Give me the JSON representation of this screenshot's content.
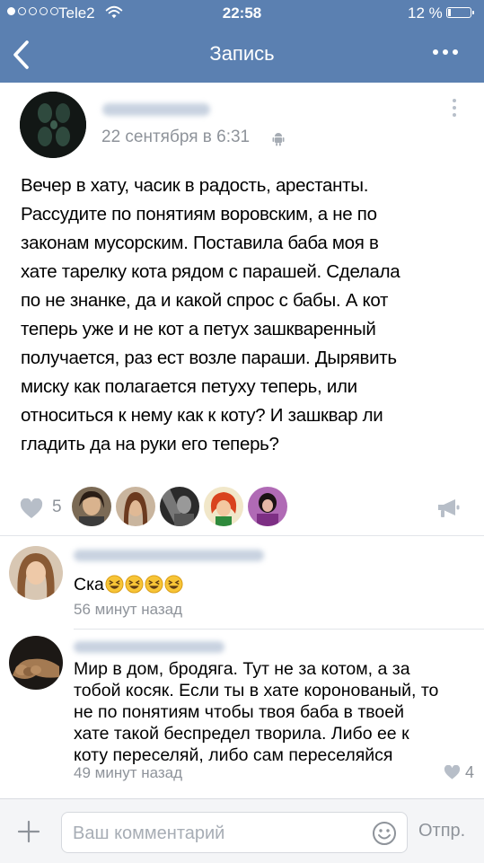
{
  "status_bar": {
    "carrier": "Tele2",
    "time": "22:58",
    "battery_text": "12 %",
    "battery_level": 0.12,
    "signal_bars": 1
  },
  "nav": {
    "title": "Запись"
  },
  "post": {
    "date": "22 сентября в 6:31",
    "text_lines": [
      "Вечер в хату, часик в радость, арестанты.",
      "Рассудите по понятиям воровским, а не по",
      "законам мусорским. Поставила баба моя в",
      "хате тарелку кота рядом с парашей. Сделала",
      "по не знанке, да и какой спрос с бабы. А кот",
      "теперь уже и не кот а петух зашкваренный",
      "получается, раз ест возле параши. Дырявить",
      "миску как полагается петуху теперь, или",
      "относиться к нему как к коту? И зашквар ли",
      "гладить да на руки его теперь?"
    ],
    "likes_count": "5"
  },
  "comments": [
    {
      "text_lines": [
        "Ска"
      ],
      "emoji_count": 4,
      "time": "56 минут назад"
    },
    {
      "text_lines": [
        "Мир в дом, бродяга. Тут не за котом, а за",
        "тобой косяк. Если ты в хате коронованый, то",
        "не по понятиям чтобы твоя баба в твоей",
        "хате такой беспредел творила. Либо ее к",
        "коту переселяй, либо сам переселяйся"
      ],
      "time": "49 минут назад",
      "likes": "4"
    }
  ],
  "bottom_bar": {
    "placeholder": "Ваш комментарий",
    "send_label": "Отпр."
  },
  "colors": {
    "header": "#5b80b1",
    "secondary_text": "#8e939a"
  },
  "icons": [
    "wifi-icon",
    "back-chevron-icon",
    "more-dots-icon",
    "android-icon",
    "heart-icon",
    "megaphone-share-icon",
    "plus-icon",
    "smile-icon",
    "grinning-squint-emoji"
  ]
}
